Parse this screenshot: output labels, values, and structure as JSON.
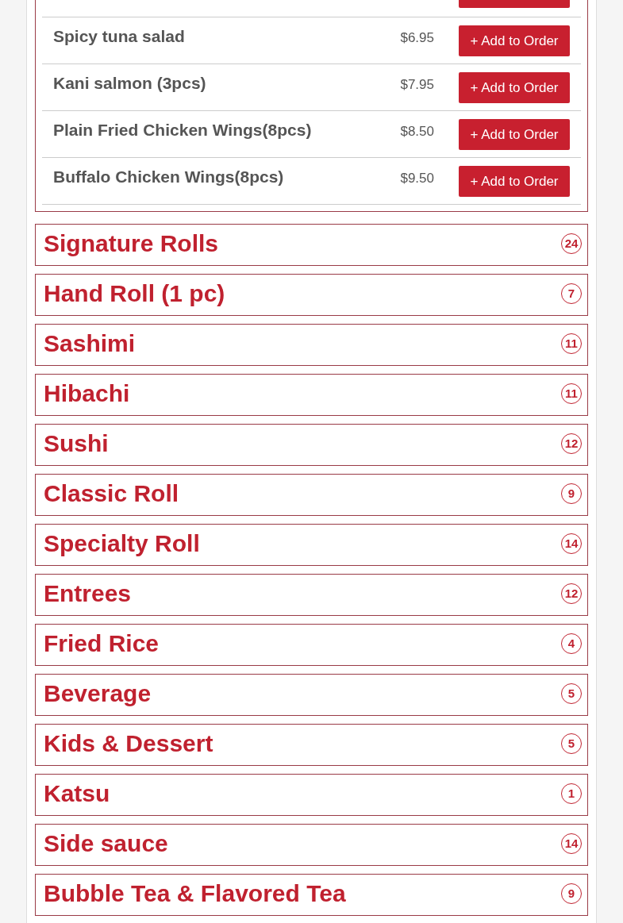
{
  "items": [
    {
      "name": "Spicy tuna salad",
      "price": "$6.95",
      "button": "+ Add to Order"
    },
    {
      "name": "Kani salmon (3pcs)",
      "price": "$7.95",
      "button": "+ Add to Order"
    },
    {
      "name": "Plain Fried Chicken Wings(8pcs)",
      "price": "$8.50",
      "button": "+ Add to Order"
    },
    {
      "name": "Buffalo Chicken Wings(8pcs)",
      "price": "$9.50",
      "button": "+ Add to Order"
    }
  ],
  "categories": [
    {
      "title": "Signature Rolls",
      "count": "24"
    },
    {
      "title": "Hand Roll (1 pc)",
      "count": "7"
    },
    {
      "title": "Sashimi",
      "count": "11"
    },
    {
      "title": "Hibachi",
      "count": "11"
    },
    {
      "title": "Sushi",
      "count": "12"
    },
    {
      "title": "Classic Roll",
      "count": "9"
    },
    {
      "title": "Specialty Roll",
      "count": "14"
    },
    {
      "title": "Entrees",
      "count": "12"
    },
    {
      "title": "Fried Rice",
      "count": "4"
    },
    {
      "title": "Beverage",
      "count": "5"
    },
    {
      "title": "Kids & Dessert",
      "count": "5"
    },
    {
      "title": "Katsu",
      "count": "1"
    },
    {
      "title": "Side sauce",
      "count": "14"
    },
    {
      "title": "Bubble Tea & Flavored Tea",
      "count": "9"
    }
  ]
}
